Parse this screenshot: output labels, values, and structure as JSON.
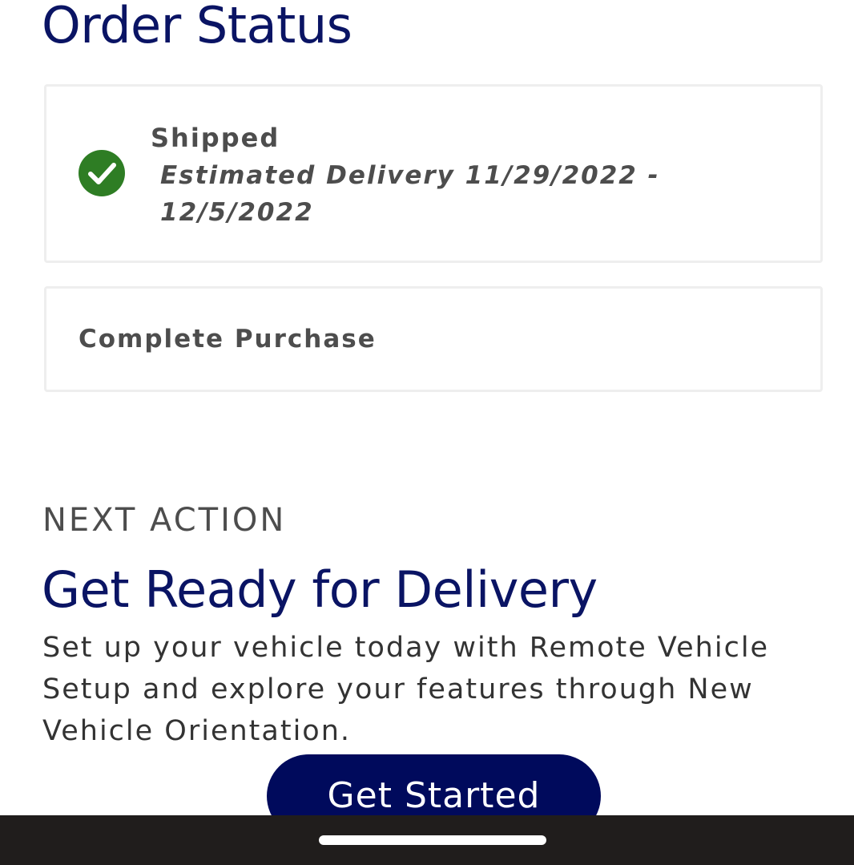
{
  "page": {
    "title": "Order Status"
  },
  "order_steps": [
    {
      "status": "Shipped",
      "detail": "Estimated Delivery 11/29/2022 - 12/5/2022",
      "icon": "check-circle-icon",
      "icon_color": "#2e7d24",
      "completed": true
    },
    {
      "status": "Complete Purchase",
      "completed": false
    }
  ],
  "next_action": {
    "label": "NEXT ACTION",
    "heading": "Get Ready for Delivery",
    "description": "Set up your vehicle today with Remote Vehicle Setup and explore your features through New Vehicle Orientation.",
    "button_label": "Get Started"
  },
  "theme": {
    "brand_navy": "#0a1464",
    "button_navy": "#000a5c",
    "text_gray": "#4d4d4d",
    "nav_bar_color": "#201d1c"
  }
}
